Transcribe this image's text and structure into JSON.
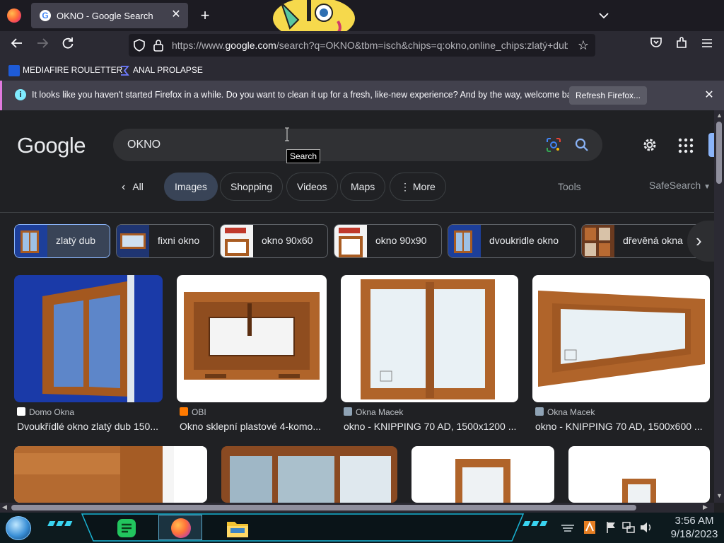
{
  "browser": {
    "tab_title": "OKNO - Google Search",
    "tab_close": "✕",
    "new_tab": "+",
    "url_prefix": "https://www.",
    "url_host": "google.com",
    "url_rest": "/search?q=OKNO&tbm=isch&chips=q:okno,online_chips:zlatý+dub&",
    "bookmarks": [
      "MEDIAFIRE ROULETTER",
      "ANAL PROLAPSE"
    ]
  },
  "notification": {
    "text": "It looks like you haven't started Firefox in a while. Do you want to clean it up for a fresh, like-new experience? And by the way, welcome back!",
    "button": "Refresh Firefox..."
  },
  "google": {
    "logo": "Google",
    "query": "OKNO",
    "tooltip": "Search",
    "tabs": {
      "all": "All",
      "images": "Images",
      "shopping": "Shopping",
      "videos": "Videos",
      "maps": "Maps",
      "more": "More"
    },
    "tools": "Tools",
    "safesearch": "SafeSearch",
    "refinements": [
      "zlatý dub",
      "fixni okno",
      "okno 90x60",
      "okno 90x90",
      "dvoukridle okno",
      "dřevěná okna"
    ],
    "results": [
      {
        "source": "Domo Okna",
        "title": "Dvoukřídlé okno zlatý dub 150..."
      },
      {
        "source": "OBI",
        "title": "Okno sklepní plastové 4-komo..."
      },
      {
        "source": "Okna Macek",
        "title": "okno - KNIPPING 70 AD, 1500x1200 ..."
      },
      {
        "source": "Okna Macek",
        "title": "okno - KNIPPING 70 AD, 1500x600 ..."
      }
    ]
  },
  "taskbar": {
    "time": "3:56 AM",
    "date": "9/18/2023"
  },
  "colors": {
    "accent": "#8ab4f8",
    "page_bg": "#202124",
    "wood": "#b0642a"
  }
}
